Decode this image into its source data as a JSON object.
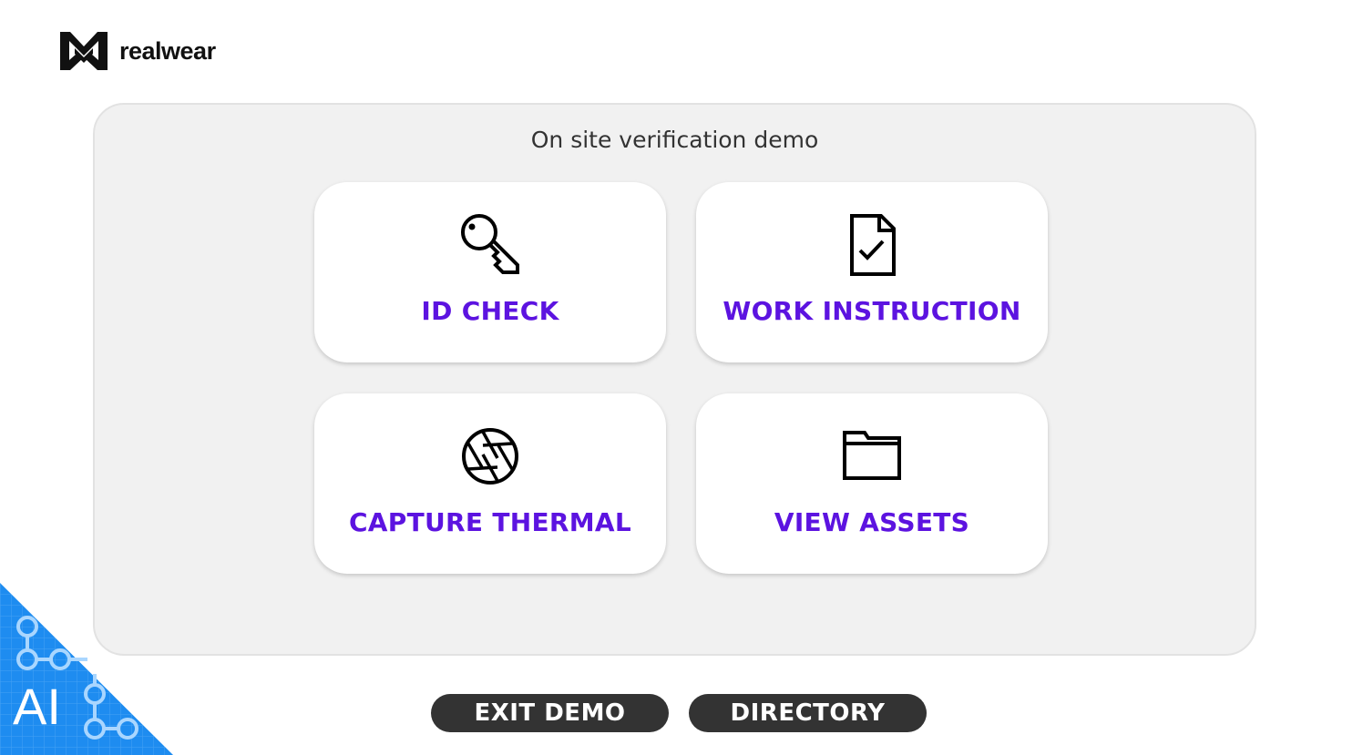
{
  "brand": {
    "name": "realwear",
    "logo_icon": "realwear-logo-icon"
  },
  "panel": {
    "title": "On site verification demo"
  },
  "tiles": [
    {
      "label": "ID CHECK",
      "icon": "key-icon"
    },
    {
      "label": "WORK INSTRUCTION",
      "icon": "document-check-icon"
    },
    {
      "label": "CAPTURE THERMAL",
      "icon": "camera-aperture-icon"
    },
    {
      "label": "VIEW ASSETS",
      "icon": "folder-icon"
    }
  ],
  "footer": {
    "exit_label": "EXIT DEMO",
    "directory_label": "DIRECTORY"
  },
  "badge": {
    "text": "AI",
    "icon": "ai-circuit-badge-icon"
  },
  "colors": {
    "accent": "#5c13e0",
    "panel_bg": "#f1f1f1",
    "pill_bg": "#333333",
    "badge_blue": "#1e8cf0"
  }
}
